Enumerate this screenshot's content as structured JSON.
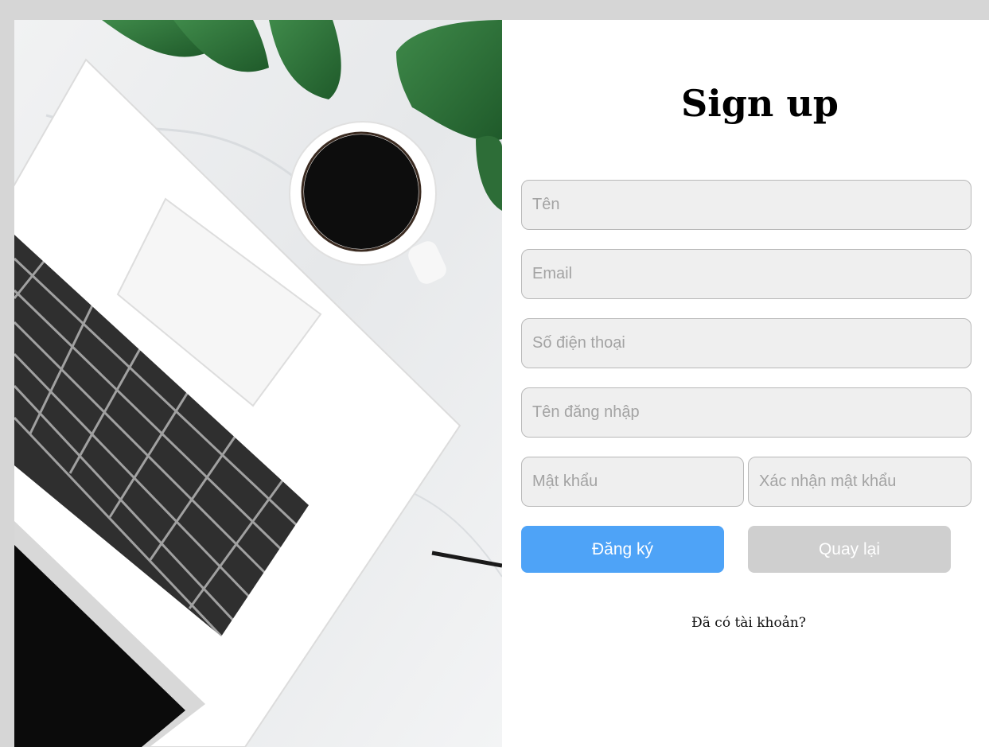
{
  "page": {
    "title": "Sign up"
  },
  "form": {
    "name": {
      "placeholder": "Tên",
      "value": ""
    },
    "email": {
      "placeholder": "Email",
      "value": ""
    },
    "phone": {
      "placeholder": "Số điện thoại",
      "value": ""
    },
    "username": {
      "placeholder": "Tên đăng nhập",
      "value": ""
    },
    "password": {
      "placeholder": "Mật khẩu",
      "value": ""
    },
    "confirm_password": {
      "placeholder": "Xác nhận mật khẩu",
      "value": ""
    },
    "submit_label": "Đăng ký",
    "back_label": "Quay lại",
    "login_link": "Đã có tài khoản?"
  },
  "colors": {
    "page_background": "#d6d6d6",
    "primary_button": "#4ea3f7",
    "secondary_button": "#cfcfcf",
    "input_background": "#efefef",
    "input_border": "#b8b8b8"
  },
  "hero": {
    "icon": "laptop-coffee-photo"
  }
}
